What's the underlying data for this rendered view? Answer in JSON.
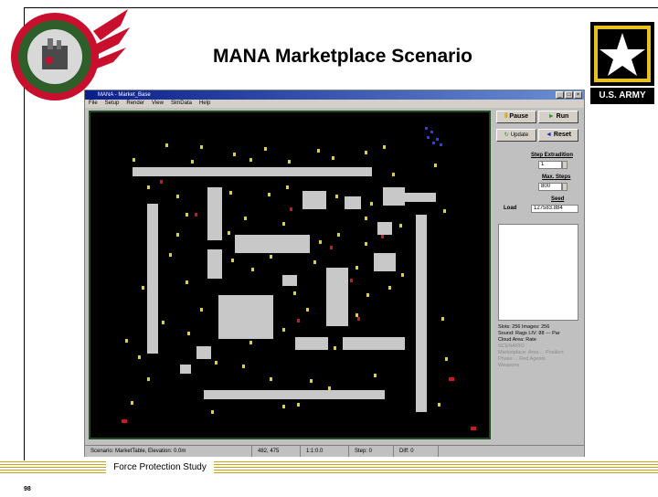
{
  "slide": {
    "title": "MANA Marketplace Scenario",
    "footer": "Force Protection Study",
    "page_number": "98",
    "army_logo_text": "U.S. ARMY"
  },
  "app": {
    "window_title": "MANA - Market_Base",
    "menu": [
      "File",
      "Setup",
      "Render",
      "View",
      "SimData",
      "Help"
    ],
    "buttons": {
      "pause": "Pause",
      "run": "Run",
      "update": "Update",
      "reset": "Reset"
    },
    "step_label": "Step Extradition",
    "step_value": "1",
    "max_steps_label": "Max. Steps",
    "max_steps_value": "800",
    "seed_label": "Seed",
    "load_label": "Load",
    "seed_value": "127583.884",
    "stats": {
      "line1": "Slots: 256   Images: 256",
      "line2": "Sound: Rags LIV: 88   --- Par",
      "line3": "Cloud Area:   Rate",
      "faint1": "SCENARIO",
      "faint2": "Marketplace: Area ... Position",
      "faint3": "Phase ... Red Agents",
      "faint4": "Weapons"
    },
    "status": {
      "left": "Scenario: MarketTable, Elevation: 0.0m",
      "coords": "482, 475",
      "zoom": "1:1:0.0",
      "step": "Step: 0",
      "extra": "Diff: 0"
    }
  },
  "colors": {
    "title_bar": "#0a1e8c",
    "map_bg": "#000000",
    "map_border": "#1f4d1f",
    "building": "#c8c8c8",
    "blue_agents": "#2a3cff",
    "yellow_agents": "#e8d020",
    "red_agents": "#d01818",
    "footer_band": "#c8a415"
  },
  "icons": {
    "left_logo": "crest-logo-icon",
    "right_logo": "army-star-logo-icon"
  }
}
